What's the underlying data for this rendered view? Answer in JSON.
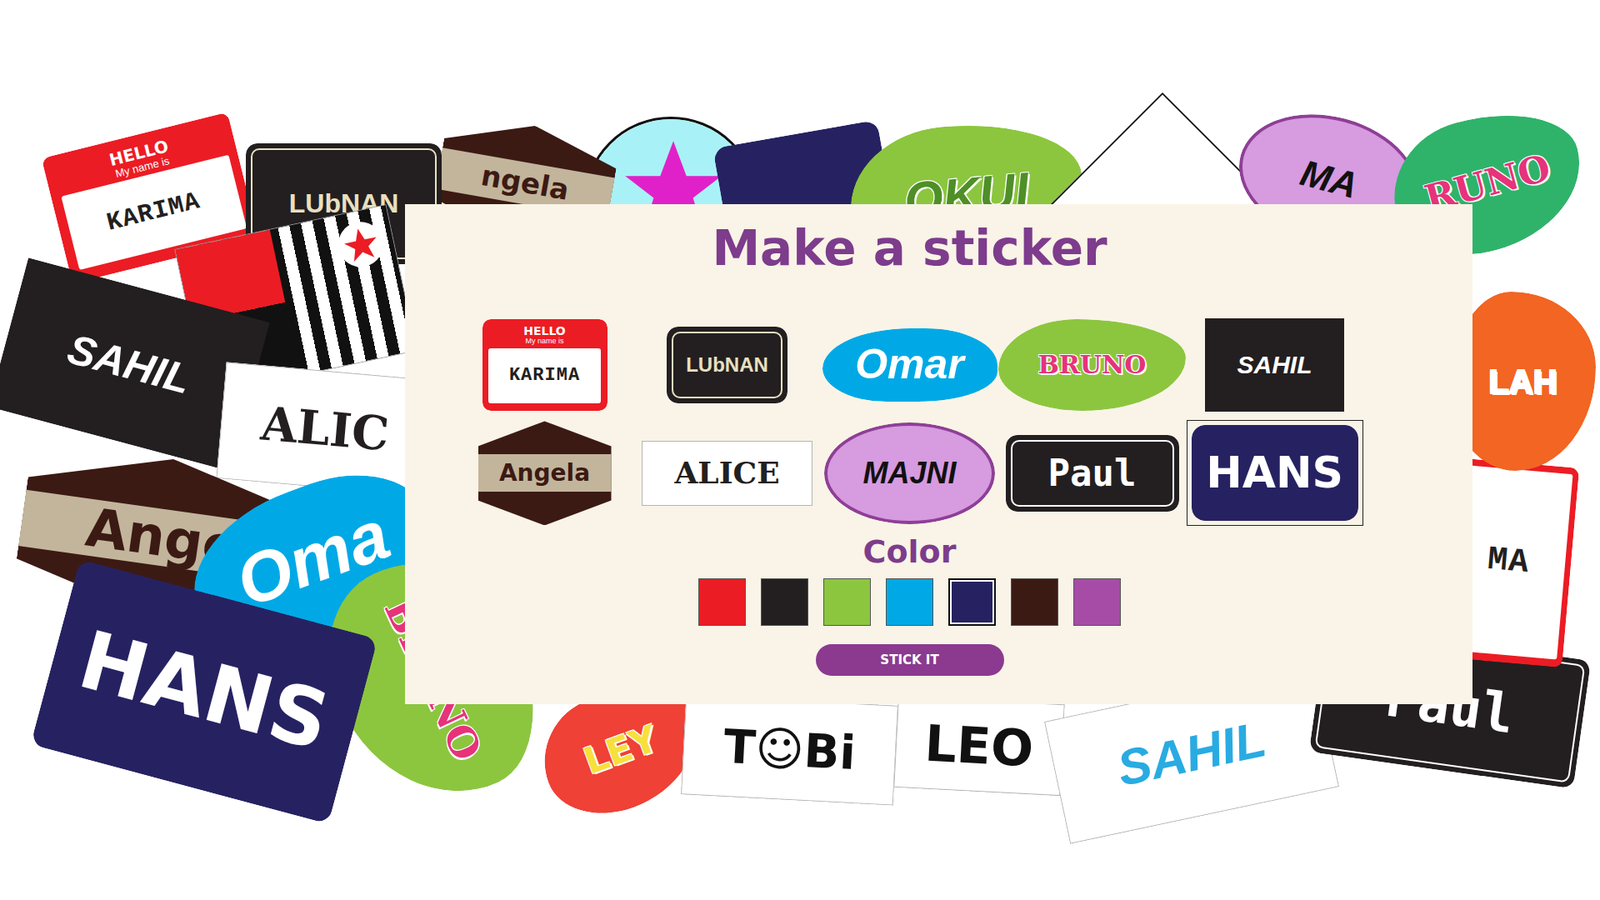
{
  "dialog": {
    "title": "Make a sticker",
    "color_label": "Color",
    "button": "STICK IT"
  },
  "stickers": [
    {
      "name": "KARIMA",
      "kind": "nametag",
      "color": "#ec1c24",
      "ink": "#231f20",
      "header": "HELLO",
      "subheader": "My name is",
      "selected": false
    },
    {
      "name": "LUbNAN",
      "kind": "dark",
      "color": "#231f20",
      "ink": "#e8e0c0",
      "selected": false
    },
    {
      "name": "Omar",
      "kind": "swoosh",
      "color": "#00a9e6",
      "ink": "#ffffff",
      "selected": false
    },
    {
      "name": "BRUNO",
      "kind": "blob",
      "color": "#8cc63f",
      "ink": "#e6337a",
      "selected": false
    },
    {
      "name": "SAHIL",
      "kind": "rect",
      "color": "#231f20",
      "ink": "#ffffff",
      "selected": false
    },
    {
      "name": "Angela",
      "kind": "hex",
      "color": "#3c1a14",
      "ink": "#3c1a14",
      "selected": false
    },
    {
      "name": "ALICE",
      "kind": "white",
      "color": "#ffffff",
      "ink": "#231f20",
      "selected": false
    },
    {
      "name": "MAJNI",
      "kind": "oval",
      "color": "#d79be0",
      "ink": "#111111",
      "selected": false
    },
    {
      "name": "Paul",
      "kind": "dark",
      "color": "#231f20",
      "ink": "#ffffff",
      "selected": false
    },
    {
      "name": "HANS",
      "kind": "plain",
      "color": "#262262",
      "ink": "#ffffff",
      "selected": true
    }
  ],
  "colors": [
    {
      "color": "#ec1c24",
      "selected": false
    },
    {
      "color": "#231f20",
      "selected": false
    },
    {
      "color": "#8cc63f",
      "selected": false
    },
    {
      "color": "#00a9e6",
      "selected": false
    },
    {
      "color": "#262262",
      "selected": true
    },
    {
      "color": "#3c1a14",
      "selected": false
    },
    {
      "color": "#a64ca6",
      "selected": false
    }
  ],
  "background": [
    {
      "kind": "circle",
      "color": "#a8f2f7"
    },
    {
      "kind": "plain",
      "color": "#262262"
    },
    {
      "kind": "blob",
      "color": "#8cc63f",
      "text": "OKUI",
      "ink": "#4f8f27"
    },
    {
      "kind": "diamond",
      "color": "#ffffff"
    },
    {
      "kind": "oval",
      "color": "#d79be0",
      "text": "MA",
      "ink": "#111111"
    },
    {
      "kind": "blob",
      "color": "#2fb36a",
      "text": "RUNO",
      "ink": "#e6337a"
    },
    {
      "kind": "hex",
      "color": "#3c1a14",
      "text": "ngela",
      "ink": "#3c1a14"
    },
    {
      "kind": "nametag",
      "color": "#ec1c24",
      "header": "HELLO",
      "subheader": "My name is",
      "text": "KARIMA",
      "ink": "#231f20"
    },
    {
      "kind": "dark",
      "color": "#231f20",
      "text": "LUbNAN",
      "ink": "#e8e0c0"
    },
    {
      "kind": "flag",
      "color": "#ec1c24"
    },
    {
      "kind": "rect",
      "color": "#231f20",
      "text": "SAHIL",
      "ink": "#ffffff"
    },
    {
      "kind": "white",
      "color": "#ffffff",
      "text": "ALIC",
      "ink": "#231f20"
    },
    {
      "kind": "hex",
      "color": "#3c1a14",
      "text": "Ange",
      "ink": "#3c1a14"
    },
    {
      "kind": "swoosh",
      "color": "#00a9e6",
      "text": "Oma",
      "ink": "#ffffff"
    },
    {
      "kind": "blob",
      "color": "#8cc63f",
      "text": "BRUNO",
      "ink": "#e6337a"
    },
    {
      "kind": "blob",
      "color": "#ef4136",
      "text": "LEY",
      "ink": "#f7e03c"
    },
    {
      "kind": "plain",
      "color": "#262262",
      "text": "HANS",
      "ink": "#ffffff"
    },
    {
      "kind": "white",
      "color": "#ffffff",
      "text": "T☺Bi",
      "ink": "#111111"
    },
    {
      "kind": "white",
      "color": "#ffffff",
      "text": "LEO",
      "ink": "#111111"
    },
    {
      "kind": "white",
      "color": "#ffffff",
      "text": "SAHIL",
      "ink": "#29abe2"
    },
    {
      "kind": "dark",
      "color": "#231f20",
      "text": "Paul",
      "ink": "#ffffff"
    },
    {
      "kind": "nametag",
      "color": "#ec1c24",
      "text": "MA",
      "ink": "#231f20"
    },
    {
      "kind": "blob",
      "color": "#f26522",
      "text": "LAH",
      "ink": "#ffffff"
    }
  ]
}
